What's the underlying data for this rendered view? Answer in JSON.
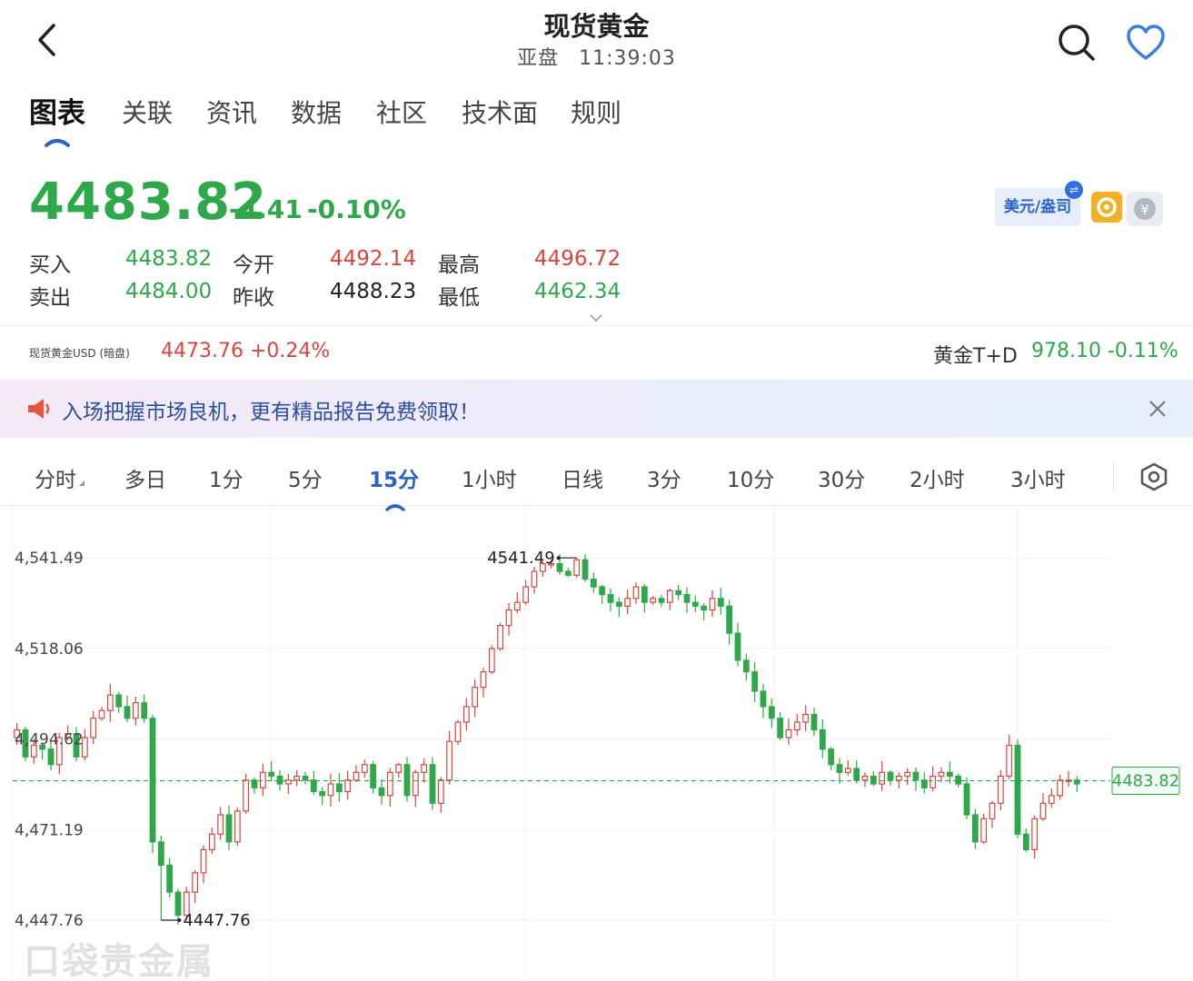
{
  "header": {
    "title": "现货黄金",
    "market": "亚盘",
    "time": "11:39:03"
  },
  "tabs": [
    {
      "label": "图表",
      "active": true
    },
    {
      "label": "关联",
      "active": false
    },
    {
      "label": "资讯",
      "active": false
    },
    {
      "label": "数据",
      "active": false
    },
    {
      "label": "社区",
      "active": false
    },
    {
      "label": "技术面",
      "active": false
    },
    {
      "label": "规则",
      "active": false
    }
  ],
  "price": {
    "last": "4483.82",
    "change": "-4.41",
    "change_pct": "-0.10%"
  },
  "currency_button": "美元/盎司",
  "quote": {
    "buy_label": "买入",
    "buy": "4483.82",
    "sell_label": "卖出",
    "sell": "4484.00",
    "open_label": "今开",
    "open": "4492.14",
    "prev_close_label": "昨收",
    "prev_close": "4488.23",
    "high_label": "最高",
    "high": "4496.72",
    "low_label": "最低",
    "low": "4462.34"
  },
  "reference": {
    "usd_dark_label": "现货黄金USD (暗盘)",
    "usd_dark_value": "4473.76 +0.24%",
    "td_label": "黄金T+D",
    "td_value": "978.10 -0.11%"
  },
  "banner": {
    "text": "入场把握市场良机，更有精品报告免费领取！"
  },
  "periods": [
    {
      "label": "分时",
      "active": false,
      "has_dropdown": true
    },
    {
      "label": "多日",
      "active": false
    },
    {
      "label": "1分",
      "active": false
    },
    {
      "label": "5分",
      "active": false
    },
    {
      "label": "15分",
      "active": true
    },
    {
      "label": "1小时",
      "active": false
    },
    {
      "label": "日线",
      "active": false
    },
    {
      "label": "3分",
      "active": false
    },
    {
      "label": "10分",
      "active": false
    },
    {
      "label": "30分",
      "active": false
    },
    {
      "label": "2小时",
      "active": false
    },
    {
      "label": "3小时",
      "active": false
    }
  ],
  "colors": {
    "up": "#d9453e",
    "down": "#2ea84a",
    "accent": "#2a63c8"
  },
  "chart_data": {
    "type": "candlestick",
    "interval": "15分",
    "y_tick_labels": [
      "4,541.49",
      "4,518.06",
      "4,494.62",
      "4,471.19",
      "4,447.76"
    ],
    "y_ticks": [
      4541.49,
      4518.06,
      4494.62,
      4471.19,
      4447.76
    ],
    "ylim": [
      4436,
      4550
    ],
    "max_annotation": {
      "label": "4541.49",
      "value": 4541.49,
      "index": 66
    },
    "min_annotation": {
      "label": "4447.76",
      "value": 4447.76,
      "index": 17
    },
    "current_price": {
      "label": "4483.82",
      "value": 4483.82
    },
    "watermark": "口袋贵金属",
    "closes": [
      4497,
      4490,
      4493,
      4492,
      4488,
      4495,
      4496,
      4490,
      4495,
      4500,
      4502,
      4506,
      4503,
      4500,
      4504,
      4500,
      4468,
      4462,
      4455,
      4449,
      4455,
      4460,
      4466,
      4470,
      4475,
      4468,
      4476,
      4484,
      4482,
      4486,
      4485,
      4483,
      4484,
      4485,
      4484,
      4481,
      4480,
      4483,
      4481,
      4484,
      4486,
      4488,
      4482,
      4480,
      4486,
      4488,
      4480,
      4486,
      4488,
      4478,
      4484,
      4494,
      4499,
      4503,
      4508,
      4512,
      4518,
      4524,
      4528,
      4530,
      4534,
      4538,
      4540,
      4540,
      4538,
      4537,
      4541,
      4536,
      4534,
      4532,
      4530,
      4529,
      4531,
      4534,
      4530,
      4531,
      4530,
      4533,
      4532,
      4530,
      4529,
      4528,
      4531,
      4529,
      4522,
      4515,
      4512,
      4507,
      4503,
      4500,
      4495,
      4497,
      4499,
      4501,
      4497,
      4492,
      4488,
      4486,
      4487,
      4484,
      4485,
      4483,
      4486,
      4484,
      4485,
      4486,
      4484,
      4482,
      4485,
      4486,
      4485,
      4483,
      4475,
      4468,
      4474,
      4478,
      4485,
      4493,
      4470,
      4466,
      4474,
      4478,
      4480,
      4484,
      4484,
      4483
    ]
  }
}
